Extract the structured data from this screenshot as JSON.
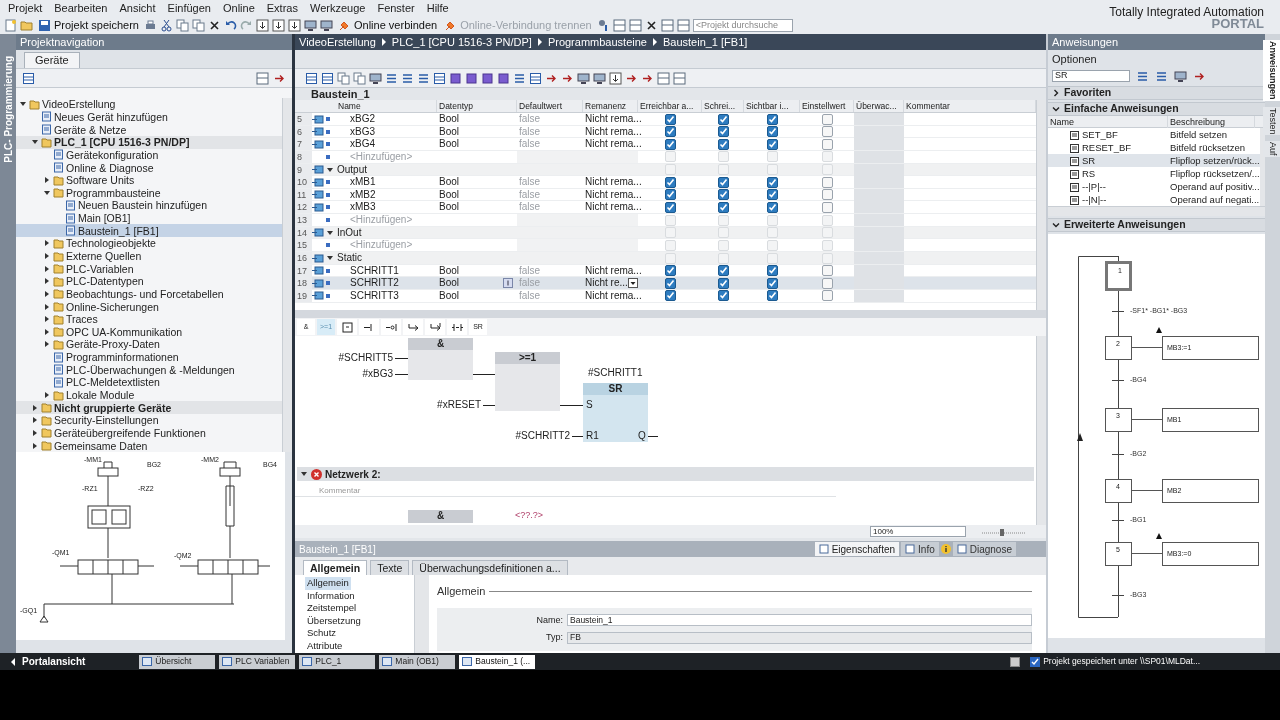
{
  "menu": [
    "Projekt",
    "Bearbeiten",
    "Ansicht",
    "Einfügen",
    "Online",
    "Extras",
    "Werkzeuge",
    "Fenster",
    "Hilfe"
  ],
  "toolbar": {
    "buttons": [
      {
        "label": "Projekt speichern",
        "disabled": false
      },
      {
        "label": "Online verbinden",
        "disabled": false
      },
      {
        "label": "Online-Verbindung trennen",
        "disabled": true
      }
    ],
    "search_placeholder": "<Projekt durchsuche"
  },
  "branding": {
    "line1": "Totally Integrated Automation",
    "line2": "PORTAL"
  },
  "side_tab": "PLC- Programmierung",
  "navigation": {
    "title": "Projektnavigation",
    "tab": "Geräte",
    "tree": [
      {
        "label": "VideoErstellung",
        "kind": "group",
        "expanded": true,
        "bold": false,
        "selected": false,
        "children": [
          {
            "label": "Neues Gerät hinzufügen",
            "kind": "leaf",
            "bold": false,
            "selected": false
          },
          {
            "label": "Geräte & Netze",
            "kind": "leaf",
            "bold": false,
            "selected": false
          },
          {
            "label": "PLC_1 [CPU 1516-3 PN/DP]",
            "kind": "group",
            "expanded": true,
            "bold": true,
            "selected": false,
            "children": [
              {
                "label": "Gerätekonfiguration",
                "kind": "leaf",
                "bold": false,
                "selected": false
              },
              {
                "label": "Online & Diagnose",
                "kind": "leaf",
                "bold": false,
                "selected": false
              },
              {
                "label": "Software Units",
                "kind": "group",
                "expanded": false,
                "bold": false,
                "selected": false
              },
              {
                "label": "Programmbausteine",
                "kind": "group",
                "expanded": true,
                "bold": false,
                "selected": false,
                "children": [
                  {
                    "label": "Neuen Baustein hinzufügen",
                    "kind": "leaf",
                    "bold": false,
                    "selected": false
                  },
                  {
                    "label": "Main [OB1]",
                    "kind": "leaf",
                    "bold": false,
                    "selected": false
                  },
                  {
                    "label": "Baustein_1 [FB1]",
                    "kind": "leaf",
                    "bold": false,
                    "selected": true
                  }
                ]
              },
              {
                "label": "Technologieobjekte",
                "kind": "group",
                "expanded": false,
                "bold": false,
                "selected": false
              },
              {
                "label": "Externe Quellen",
                "kind": "group",
                "expanded": false,
                "bold": false,
                "selected": false
              },
              {
                "label": "PLC-Variablen",
                "kind": "group",
                "expanded": false,
                "bold": false,
                "selected": false
              },
              {
                "label": "PLC-Datentypen",
                "kind": "group",
                "expanded": false,
                "bold": false,
                "selected": false
              },
              {
                "label": "Beobachtungs- und Forcetabellen",
                "kind": "group",
                "expanded": false,
                "bold": false,
                "selected": false
              },
              {
                "label": "Online-Sicherungen",
                "kind": "group",
                "expanded": false,
                "bold": false,
                "selected": false
              },
              {
                "label": "Traces",
                "kind": "group",
                "expanded": false,
                "bold": false,
                "selected": false
              },
              {
                "label": "OPC UA-Kommunikation",
                "kind": "group",
                "expanded": false,
                "bold": false,
                "selected": false
              },
              {
                "label": "Geräte-Proxy-Daten",
                "kind": "group",
                "expanded": false,
                "bold": false,
                "selected": false
              },
              {
                "label": "Programminformationen",
                "kind": "leaf",
                "bold": false,
                "selected": false
              },
              {
                "label": "PLC-Überwachungen & -Meldungen",
                "kind": "leaf",
                "bold": false,
                "selected": false
              },
              {
                "label": "PLC-Meldetextlisten",
                "kind": "leaf",
                "bold": false,
                "selected": false
              },
              {
                "label": "Lokale Module",
                "kind": "group",
                "expanded": false,
                "bold": false,
                "selected": false
              }
            ]
          },
          {
            "label": "Nicht gruppierte Geräte",
            "kind": "group",
            "expanded": false,
            "bold": true,
            "selected": false
          },
          {
            "label": "Security-Einstellungen",
            "kind": "group",
            "expanded": false,
            "bold": false,
            "selected": false
          },
          {
            "label": "Geräteübergreifende Funktionen",
            "kind": "group",
            "expanded": false,
            "bold": false,
            "selected": false
          },
          {
            "label": "Gemeinsame Daten",
            "kind": "group",
            "expanded": false,
            "bold": false,
            "selected": false
          }
        ]
      }
    ]
  },
  "schematic": {
    "labels": [
      "-MM1",
      "-MM2",
      "BG2",
      "BG4",
      "-RZ1",
      "-RZ2",
      "-QM1",
      "-QM2",
      "-GQ1"
    ]
  },
  "editor": {
    "breadcrumb": [
      "VideoErstellung",
      "PLC_1 [CPU 1516-3 PN/DP]",
      "Programmbausteine",
      "Baustein_1 [FB1]"
    ],
    "block_title": "Baustein_1",
    "columns": [
      "Name",
      "Datentyp",
      "Defaultwert",
      "Remanenz",
      "Erreichbar a...",
      "Schrei...",
      "Sichtbar i...",
      "Einstellwert",
      "Überwac...",
      "Kommentar"
    ],
    "rows": [
      {
        "number": "5",
        "kind": "var",
        "name": "xBG2",
        "type": "Bool",
        "default": "false",
        "retain": "Nicht rema...",
        "accessible": true,
        "writable": true,
        "visible": true,
        "setpoint": false,
        "selected": false
      },
      {
        "number": "6",
        "kind": "var",
        "name": "xBG3",
        "type": "Bool",
        "default": "false",
        "retain": "Nicht rema...",
        "accessible": true,
        "writable": true,
        "visible": true,
        "setpoint": false,
        "selected": false
      },
      {
        "number": "7",
        "kind": "var",
        "name": "xBG4",
        "type": "Bool",
        "default": "false",
        "retain": "Nicht rema...",
        "accessible": true,
        "writable": true,
        "visible": true,
        "setpoint": false,
        "selected": false
      },
      {
        "number": "8",
        "kind": "add",
        "name": "<Hinzufügen>",
        "selected": false
      },
      {
        "number": "9",
        "kind": "section",
        "name": "Output",
        "selected": false
      },
      {
        "number": "10",
        "kind": "var",
        "name": "xMB1",
        "type": "Bool",
        "default": "false",
        "retain": "Nicht rema...",
        "accessible": true,
        "writable": true,
        "visible": true,
        "setpoint": false,
        "selected": false
      },
      {
        "number": "11",
        "kind": "var",
        "name": "xMB2",
        "type": "Bool",
        "default": "false",
        "retain": "Nicht rema...",
        "accessible": true,
        "writable": true,
        "visible": true,
        "setpoint": false,
        "selected": false
      },
      {
        "number": "12",
        "kind": "var",
        "name": "xMB3",
        "type": "Bool",
        "default": "false",
        "retain": "Nicht rema...",
        "accessible": true,
        "writable": true,
        "visible": true,
        "setpoint": false,
        "selected": false
      },
      {
        "number": "13",
        "kind": "add",
        "name": "<Hinzufügen>",
        "selected": false
      },
      {
        "number": "14",
        "kind": "section",
        "name": "InOut",
        "selected": false
      },
      {
        "number": "15",
        "kind": "add",
        "name": "<Hinzufügen>",
        "selected": false
      },
      {
        "number": "16",
        "kind": "section",
        "name": "Static",
        "selected": false
      },
      {
        "number": "17",
        "kind": "var",
        "name": "SCHRITT1",
        "type": "Bool",
        "default": "false",
        "retain": "Nicht rema...",
        "accessible": true,
        "writable": true,
        "visible": true,
        "setpoint": false,
        "selected": false
      },
      {
        "number": "18",
        "kind": "var",
        "name": "SCHRITT2",
        "type": "Bool",
        "default": "false",
        "retain": "Nicht re...",
        "accessible": true,
        "writable": true,
        "visible": true,
        "setpoint": false,
        "selected": true
      },
      {
        "number": "19",
        "kind": "var",
        "name": "SCHRITT3",
        "type": "Bool",
        "default": "false",
        "retain": "Nicht rema...",
        "accessible": true,
        "writable": true,
        "visible": true,
        "setpoint": false,
        "selected": false
      }
    ],
    "instructions": [
      {
        "label": "&",
        "selected": false
      },
      {
        "label": ">=1",
        "selected": true
      },
      {
        "label": "SR",
        "selected": false
      }
    ],
    "network1": {
      "and_label": "&",
      "and_inputs": [
        "#SCHRITT5",
        "#xBG3"
      ],
      "or_label": ">=1",
      "or_input": "#xRESET",
      "sr_operand": "#SCHRITT1",
      "sr_label": "SR",
      "set_pin": "S",
      "reset_pin": "R1",
      "reset_input": "#SCHRITT2",
      "output_pin": "Q"
    },
    "network2": {
      "title": "Netzwerk 2:",
      "error": true,
      "expanded": true,
      "comment": "Kommentar",
      "block_label": "&",
      "operand": "<??.?>"
    },
    "zoom": "100%"
  },
  "properties": {
    "title": "Baustein_1 [FB1]",
    "tabs": [
      {
        "label": "Eigenschaften",
        "selected": true
      },
      {
        "label": "Info",
        "selected": false
      },
      {
        "label": "Diagnose",
        "selected": false
      }
    ],
    "subtabs": [
      {
        "label": "Allgemein",
        "selected": true
      },
      {
        "label": "Texte",
        "selected": false
      },
      {
        "label": "Überwachungsdefinitionen a...",
        "selected": false
      }
    ],
    "list": [
      {
        "label": "Allgemein",
        "selected": true
      },
      {
        "label": "Information",
        "selected": false
      },
      {
        "label": "Zeitstempel",
        "selected": false
      },
      {
        "label": "Übersetzung",
        "selected": false
      },
      {
        "label": "Schutz",
        "selected": false
      },
      {
        "label": "Attribute",
        "selected": false
      }
    ],
    "section": "Allgemein",
    "fields": [
      {
        "label": "Name:",
        "value": "Baustein_1",
        "readonly": false
      },
      {
        "label": "Typ:",
        "value": "FB",
        "readonly": true
      }
    ]
  },
  "instructions_panel": {
    "title": "Anweisungen",
    "options": "Optionen",
    "search": {
      "value": "SR"
    },
    "sections": [
      {
        "label": "Favoriten",
        "expanded": false
      },
      {
        "label": "Einfache Anweisungen",
        "expanded": true
      },
      {
        "label": "Erweiterte Anweisungen",
        "expanded": true
      }
    ],
    "columns": [
      "Name",
      "Beschreibung"
    ],
    "rows": [
      {
        "name": "SET_BF",
        "description": "Bitfeld setzen",
        "selected": false
      },
      {
        "name": "RESET_BF",
        "description": "Bitfeld rücksetzen",
        "selected": false
      },
      {
        "name": "SR",
        "description": "Flipflop setzen/rück...",
        "selected": true
      },
      {
        "name": "RS",
        "description": "Flipflop rücksetzen/...",
        "selected": false
      },
      {
        "name": "--|P|--",
        "description": "Operand auf positiv...",
        "selected": false
      },
      {
        "name": "--|N|--",
        "description": "Operand auf negati...",
        "selected": false
      }
    ]
  },
  "side_tabs": [
    {
      "label": "Anweisungen",
      "selected": true
    },
    {
      "label": "Testen",
      "selected": false
    },
    {
      "label": "Auf",
      "selected": false
    }
  ],
  "sfc": {
    "steps": [
      {
        "number": "1",
        "initial": true
      },
      {
        "number": "2",
        "initial": false,
        "action": "MB3:=1",
        "arrow": true
      },
      {
        "number": "3",
        "initial": false,
        "action": "MB1",
        "arrow": false
      },
      {
        "number": "4",
        "initial": false,
        "action": "MB2",
        "arrow": false
      },
      {
        "number": "5",
        "initial": false,
        "action": "MB3:=0",
        "arrow": true
      }
    ],
    "transitions": [
      "-SF1* -BG1* -BG3",
      "-BG4",
      "-BG2",
      "-BG1",
      "-BG3"
    ]
  },
  "taskbar": {
    "portal": "Portalansicht",
    "tabs": [
      {
        "label": "Übersicht",
        "selected": false
      },
      {
        "label": "PLC Variablen",
        "selected": false
      },
      {
        "label": "PLC_1",
        "selected": false
      },
      {
        "label": "Main (OB1)",
        "selected": false
      },
      {
        "label": "Baustein_1 (...",
        "selected": true
      }
    ],
    "status": "Projekt gespeichert unter \\\\SP01\\MLDat..."
  }
}
